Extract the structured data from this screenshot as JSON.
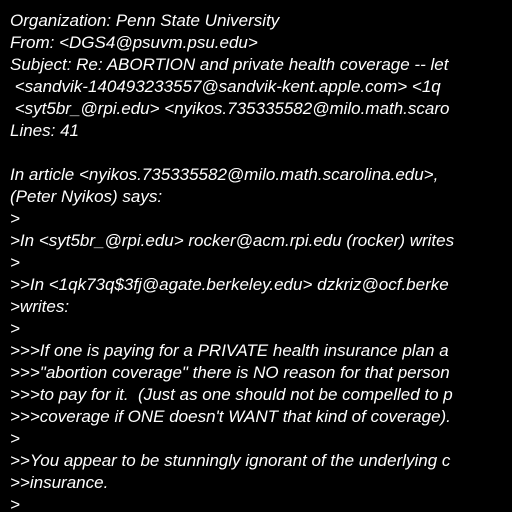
{
  "document": {
    "background_color": "#000000",
    "text_color": "#ffffff",
    "lines": [
      "Organization: Penn State University",
      "From: <DGS4@psuvm.psu.edu>",
      "Subject: Re: ABORTION and private health coverage -- let",
      " <sandvik-140493233557@sandvik-kent.apple.com> <1q",
      " <syt5br_@rpi.edu> <nyikos.735335582@milo.math.scaro",
      "Lines: 41",
      "",
      "In article <nyikos.735335582@milo.math.scarolina.edu>,",
      "(Peter Nyikos) says:",
      ">",
      ">In <syt5br_@rpi.edu> rocker@acm.rpi.edu (rocker) writes",
      ">",
      ">>In <1qk73q$3fj@agate.berkeley.edu> dzkriz@ocf.berke",
      ">writes:",
      ">",
      ">>>If one is paying for a PRIVATE health insurance plan a",
      ">>>\"abortion coverage\" there is NO reason for that person",
      ">>>to pay for it.  (Just as one should not be compelled to p",
      ">>>coverage if ONE doesn't WANT that kind of coverage).",
      ">",
      ">>You appear to be stunningly ignorant of the underlying c",
      ">>insurance.",
      ">"
    ]
  }
}
